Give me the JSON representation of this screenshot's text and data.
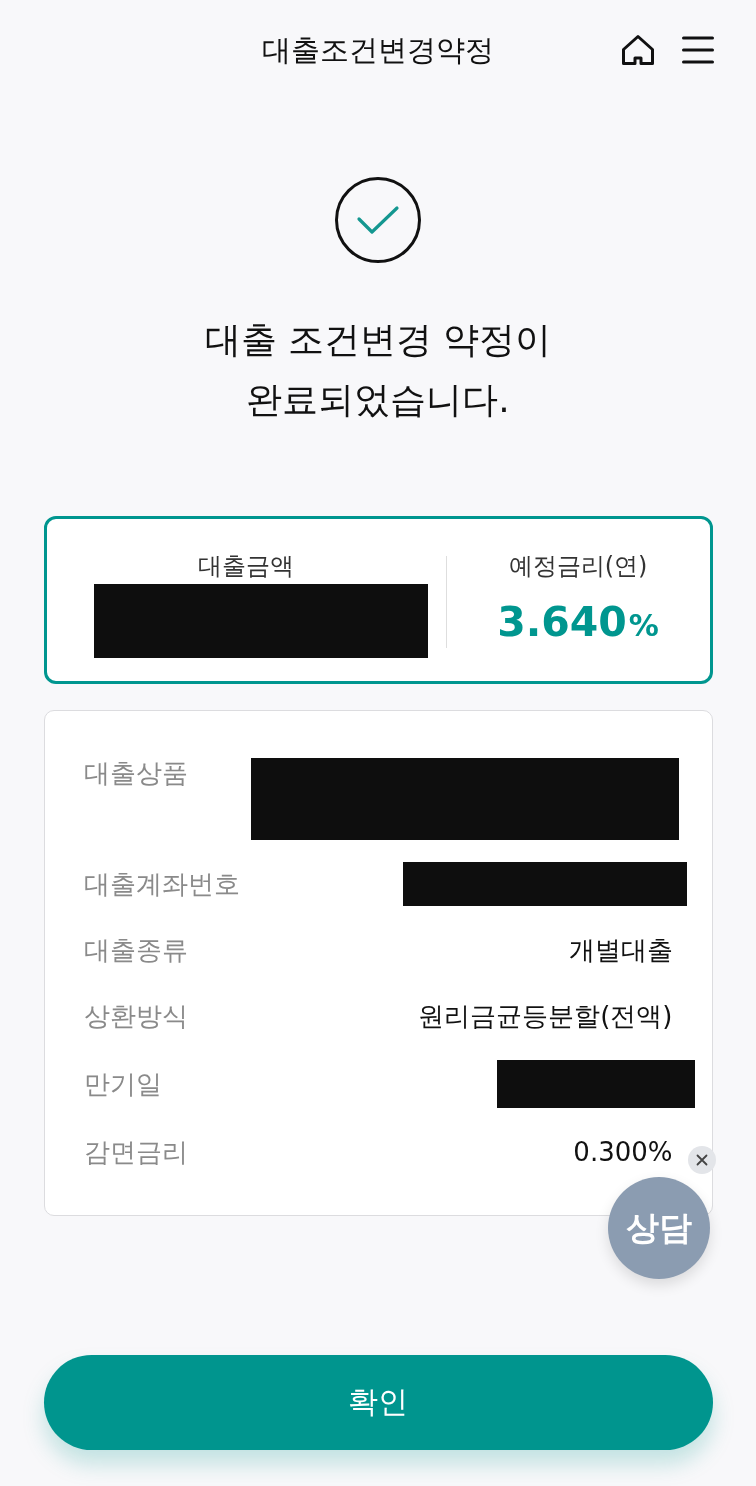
{
  "header": {
    "title": "대출조건변경약정"
  },
  "result": {
    "message": "대출 조건변경 약정이\n완료되었습니다."
  },
  "summary": {
    "items": [
      {
        "label": "대출금액",
        "kind": "redacted"
      },
      {
        "label": "예정금리(연)",
        "kind": "rate",
        "value": "3.640",
        "unit": "%"
      }
    ]
  },
  "details": {
    "rows": [
      {
        "label": "대출상품",
        "kind": "redacted"
      },
      {
        "label": "대출계좌번호",
        "kind": "redacted"
      },
      {
        "label": "대출종류",
        "kind": "text",
        "value": "개별대출"
      },
      {
        "label": "상환방식",
        "kind": "text",
        "value": "원리금균등분할(전액)"
      },
      {
        "label": "만기일",
        "kind": "redacted"
      },
      {
        "label": "감면금리",
        "kind": "text",
        "value": "0.300%"
      }
    ]
  },
  "chat": {
    "label": "상담"
  },
  "confirm": {
    "label": "확인"
  }
}
